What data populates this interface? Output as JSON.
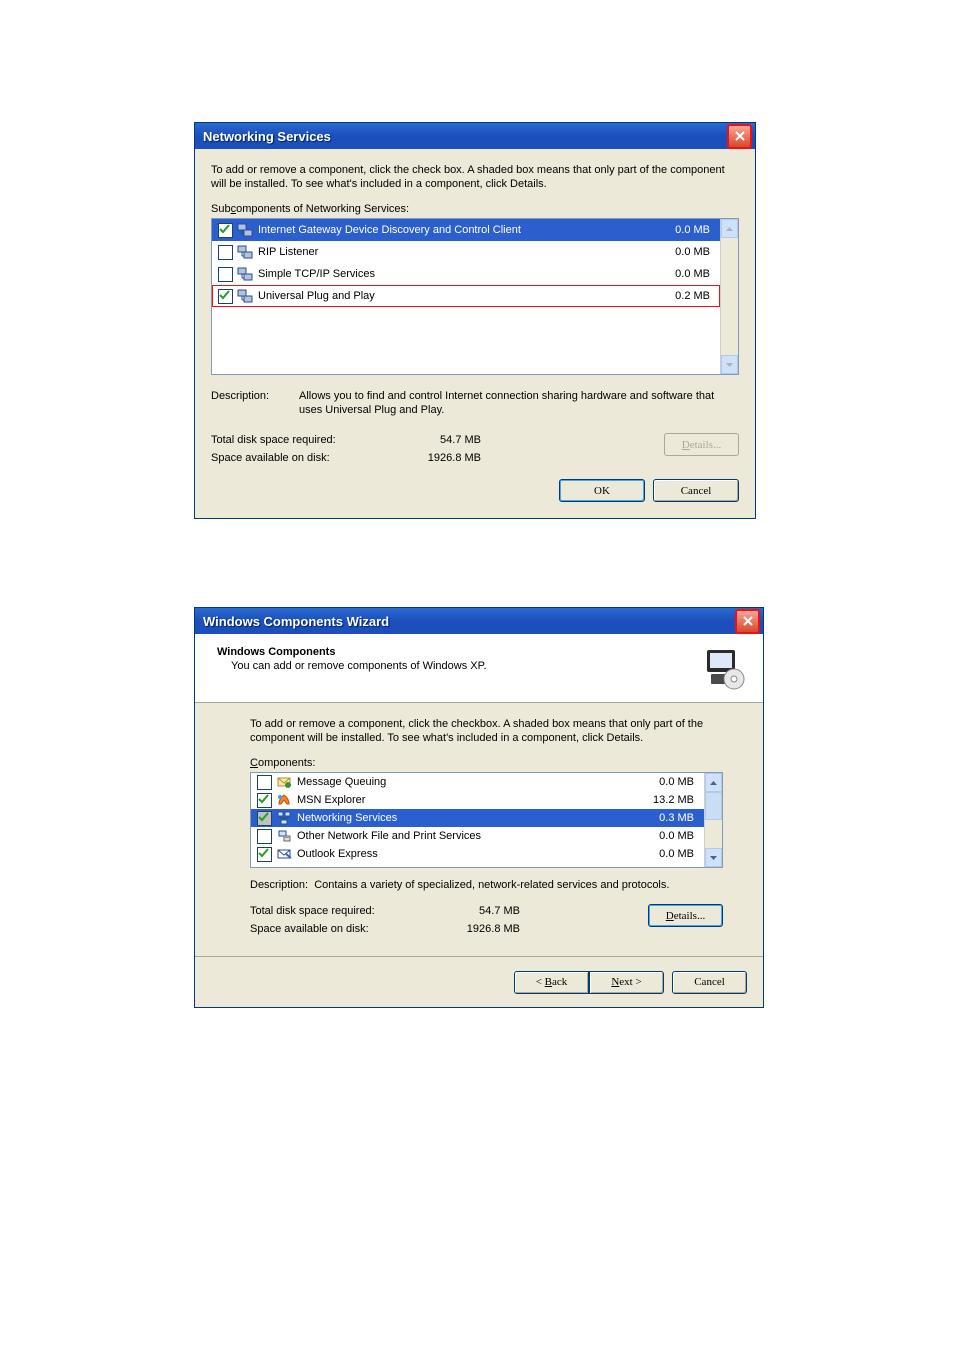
{
  "dialog1": {
    "title": "Networking Services",
    "instructions": "To add or remove a component, click the check box. A shaded box means that only part of the component will be installed. To see what's included in a component, click Details.",
    "list_label": "Subcomponents of Networking Services:",
    "items": [
      {
        "name": "Internet Gateway Device Discovery and Control Client",
        "size": "0.0 MB",
        "checked": true,
        "selected": true
      },
      {
        "name": "RIP Listener",
        "size": "0.0 MB",
        "checked": false,
        "selected": false
      },
      {
        "name": "Simple TCP/IP Services",
        "size": "0.0 MB",
        "checked": false,
        "selected": false
      },
      {
        "name": "Universal Plug and Play",
        "size": "0.2 MB",
        "checked": true,
        "selected": false,
        "highlight": true
      }
    ],
    "description_label": "Description:",
    "description_text": "Allows you to find and control Internet connection sharing hardware and software that uses Universal Plug and Play.",
    "total_label": "Total disk space required:",
    "total_value": "54.7 MB",
    "avail_label": "Space available on disk:",
    "avail_value": "1926.8 MB",
    "details_btn": "Details...",
    "ok": "OK",
    "cancel": "Cancel"
  },
  "dialog2": {
    "title": "Windows Components Wizard",
    "header_title": "Windows Components",
    "header_sub": "You can add or remove components of Windows XP.",
    "instructions": "To add or remove a component, click the checkbox.  A shaded box means that only part of the component will be installed.  To see what's included in a component, click Details.",
    "list_label": "Components:",
    "items": [
      {
        "name": "Message Queuing",
        "size": "0.0 MB",
        "checked": false,
        "selected": false,
        "tri": false,
        "icon": "msmq"
      },
      {
        "name": "MSN Explorer",
        "size": "13.2 MB",
        "checked": true,
        "selected": false,
        "tri": false,
        "icon": "msn"
      },
      {
        "name": "Networking Services",
        "size": "0.3 MB",
        "checked": true,
        "selected": true,
        "tri": true,
        "icon": "net"
      },
      {
        "name": "Other Network File and Print Services",
        "size": "0.0 MB",
        "checked": false,
        "selected": false,
        "tri": false,
        "icon": "other"
      },
      {
        "name": "Outlook Express",
        "size": "0.0 MB",
        "checked": true,
        "selected": false,
        "tri": false,
        "icon": "oe"
      }
    ],
    "description_label": "Description:",
    "description_text": "Contains a variety of specialized, network-related services and protocols.",
    "total_label": "Total disk space required:",
    "total_value": "54.7 MB",
    "avail_label": "Space available on disk:",
    "avail_value": "1926.8 MB",
    "details_btn": "Details...",
    "back": "< Back",
    "next": "Next >",
    "cancel": "Cancel"
  }
}
